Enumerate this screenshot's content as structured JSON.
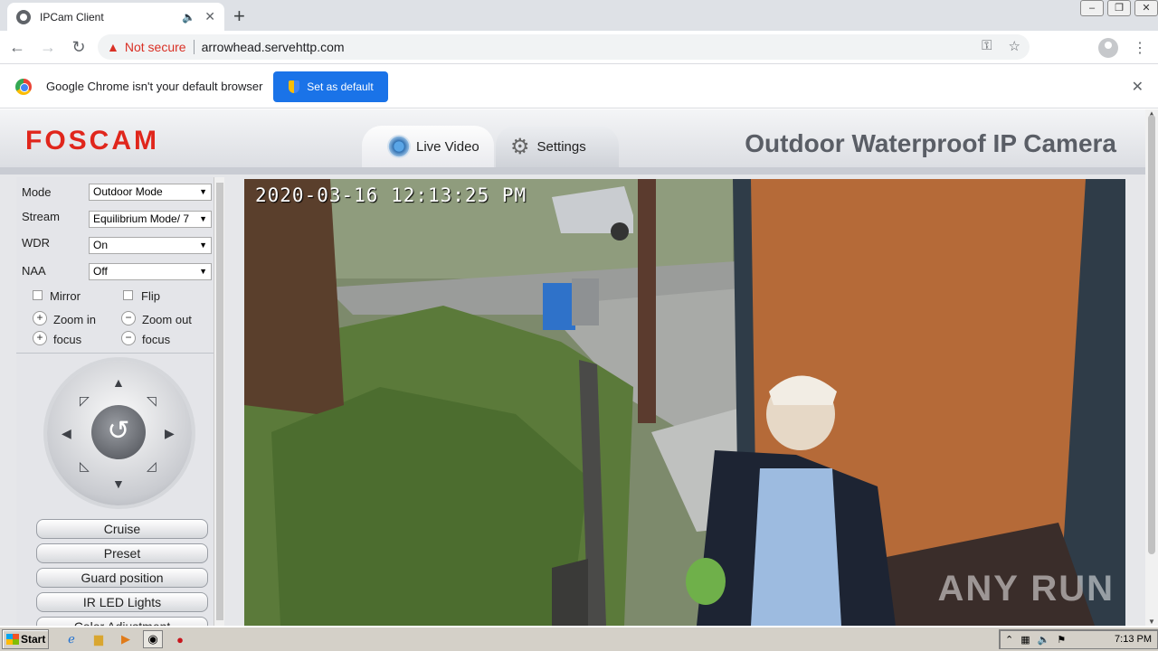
{
  "browser": {
    "tab_title": "IPCam Client",
    "security_label": "Not secure",
    "url": "arrowhead.servehttp.com",
    "info_text": "Google Chrome isn't your default browser",
    "set_default_label": "Set as default"
  },
  "header": {
    "logo": "FOSCAM",
    "product_title": "Outdoor Waterproof IP Camera",
    "tabs": {
      "live": "Live Video",
      "settings": "Settings"
    }
  },
  "controls": {
    "mode": {
      "label": "Mode",
      "value": "Outdoor Mode"
    },
    "stream": {
      "label": "Stream",
      "value": "Equilibrium Mode/ 7"
    },
    "wdr": {
      "label": "WDR",
      "value": "On"
    },
    "naa": {
      "label": "NAA",
      "value": "Off"
    },
    "mirror": "Mirror",
    "flip": "Flip",
    "zoom_in": "Zoom in",
    "zoom_out": "Zoom out",
    "focus_plus": "focus",
    "focus_minus": "focus"
  },
  "buttons": {
    "cruise": "Cruise",
    "preset": "Preset",
    "guard": "Guard position",
    "ir": "IR LED Lights",
    "color": "Color Adjustment"
  },
  "video": {
    "timestamp": "2020-03-16 12:13:25 PM",
    "watermark": "ANY RUN"
  },
  "taskbar": {
    "start": "Start",
    "clock": "7:13 PM"
  }
}
